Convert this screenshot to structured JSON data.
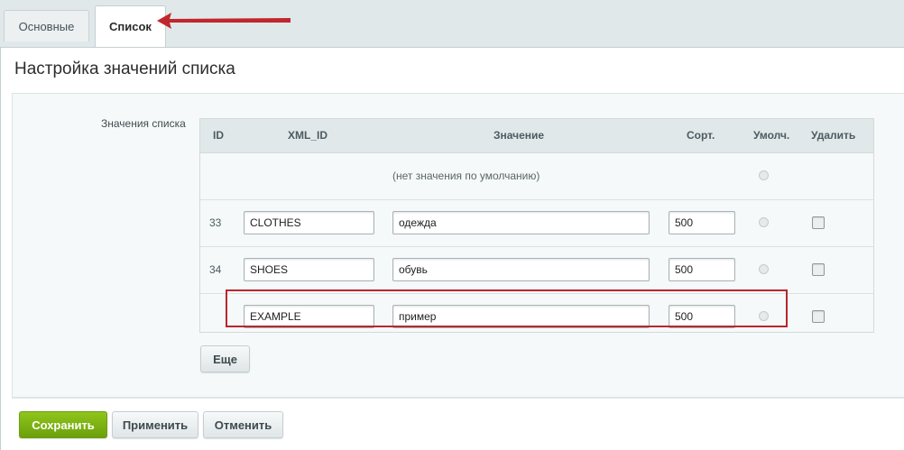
{
  "tabs": [
    {
      "label": "Основные"
    },
    {
      "label": "Список"
    }
  ],
  "page_title": "Настройка значений списка",
  "field_label": "Значения списка",
  "table": {
    "headers": [
      "ID",
      "XML_ID",
      "Значение",
      "Сорт.",
      "Умолч.",
      "Удалить"
    ],
    "no_default_text": "(нет значения по умолчанию)",
    "rows": [
      {
        "id": "33",
        "xml_id": "CLOTHES",
        "value": "одежда",
        "sort": "500"
      },
      {
        "id": "34",
        "xml_id": "SHOES",
        "value": "обувь",
        "sort": "500"
      },
      {
        "id": "",
        "xml_id": "EXAMPLE",
        "value": "пример",
        "sort": "500"
      }
    ]
  },
  "buttons": {
    "more": "Еще",
    "save": "Сохранить",
    "apply": "Применить",
    "cancel": "Отменить"
  },
  "colors": {
    "annotation_red": "#b8272e",
    "save_green": "#7cb412"
  }
}
